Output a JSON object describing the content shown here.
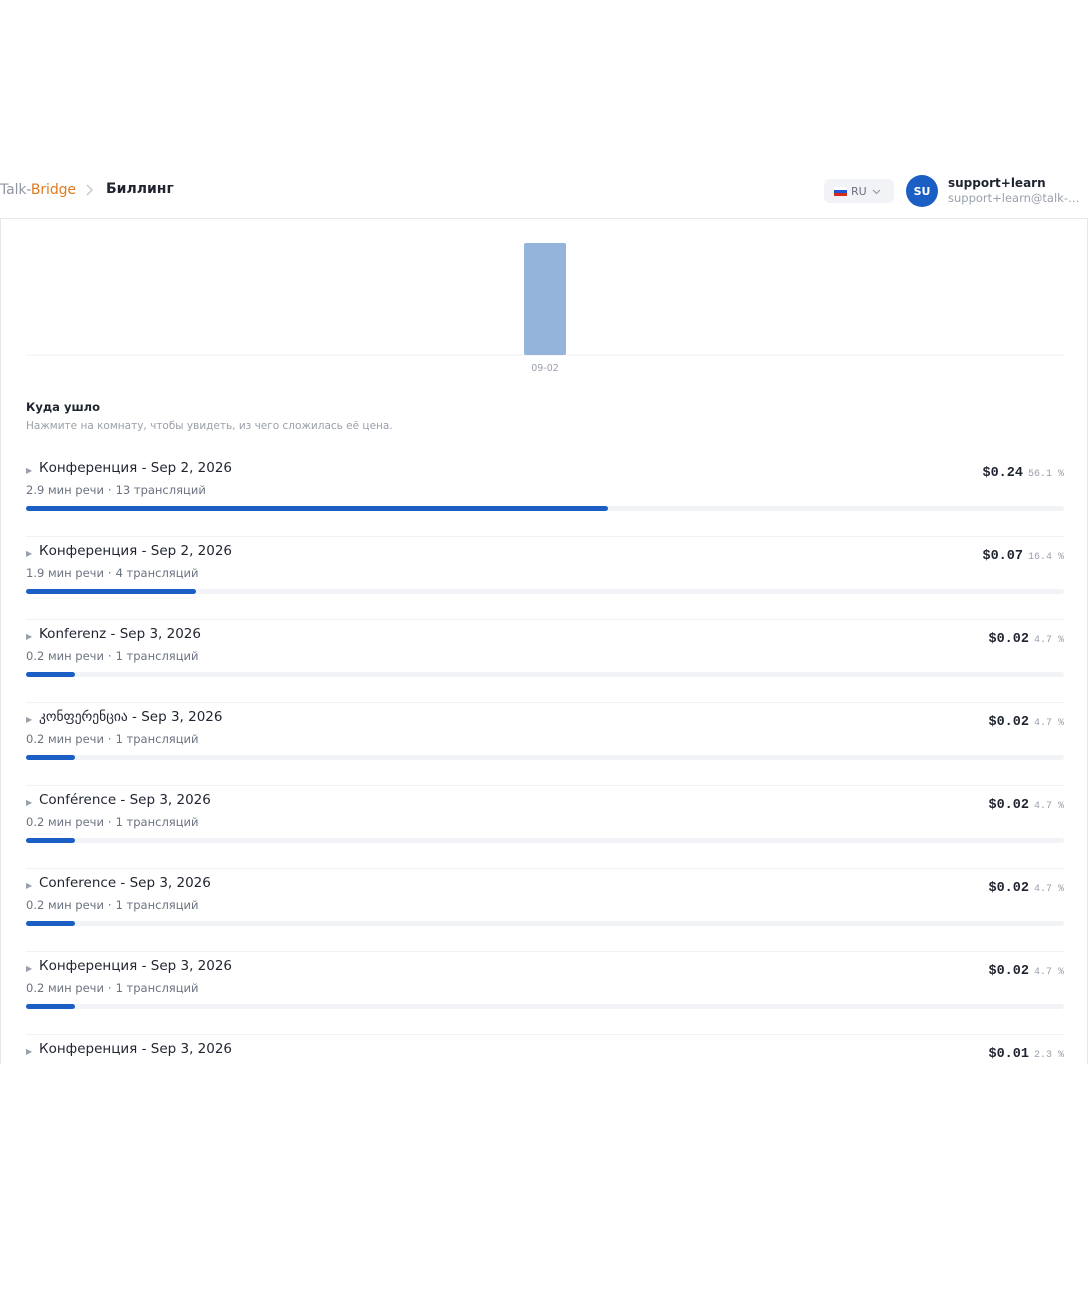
{
  "header": {
    "logo": {
      "part1": "Talk",
      "dash": "-",
      "part2": "Bridge"
    },
    "breadcrumb_title": "Биллинг",
    "language": {
      "code": "RU",
      "flag_colors": [
        "#ffffff",
        "#1c57d1",
        "#d52b1e"
      ]
    },
    "user": {
      "initials": "SU",
      "name": "support+learn",
      "email": "support+learn@talk-bridge.com"
    }
  },
  "chart_data": {
    "type": "bar",
    "categories": [
      "09-02"
    ],
    "values": [
      1
    ],
    "bar_color": "#95b4dc"
  },
  "breakdown": {
    "title": "Куда ушло",
    "subtitle": "Нажмите на комнату, чтобы увидеть, из чего сложилась её цена.",
    "rows": [
      {
        "name": "Конференция - Sep 2, 2026",
        "minutes": "2.9 мин речи",
        "streams": "13 трансляций",
        "amount": "$0.24",
        "percent": "56.1 %",
        "share": 0.561
      },
      {
        "name": "Конференция - Sep 2, 2026",
        "minutes": "1.9 мин речи",
        "streams": "4 трансляций",
        "amount": "$0.07",
        "percent": "16.4 %",
        "share": 0.164
      },
      {
        "name": "Konferenz - Sep 3, 2026",
        "minutes": "0.2 мин речи",
        "streams": "1 трансляций",
        "amount": "$0.02",
        "percent": "4.7 %",
        "share": 0.047
      },
      {
        "name": "კონფერენცია - Sep 3, 2026",
        "minutes": "0.2 мин речи",
        "streams": "1 трансляций",
        "amount": "$0.02",
        "percent": "4.7 %",
        "share": 0.047
      },
      {
        "name": "Conférence - Sep 3, 2026",
        "minutes": "0.2 мин речи",
        "streams": "1 трансляций",
        "amount": "$0.02",
        "percent": "4.7 %",
        "share": 0.047
      },
      {
        "name": "Conference - Sep 3, 2026",
        "minutes": "0.2 мин речи",
        "streams": "1 трансляций",
        "amount": "$0.02",
        "percent": "4.7 %",
        "share": 0.047
      },
      {
        "name": "Конференция - Sep 3, 2026",
        "minutes": "0.2 мин речи",
        "streams": "1 трансляций",
        "amount": "$0.02",
        "percent": "4.7 %",
        "share": 0.047
      },
      {
        "name": "Конференция - Sep 3, 2026",
        "minutes": "",
        "streams": "",
        "amount": "$0.01",
        "percent": "2.3 %",
        "share": 0.023
      }
    ]
  }
}
